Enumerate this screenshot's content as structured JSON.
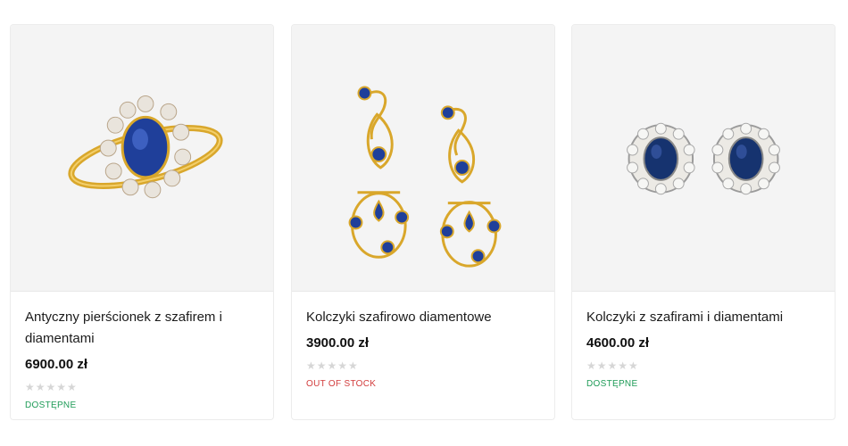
{
  "products": [
    {
      "title": "Antyczny pierścionek z szafirem i diamentami",
      "price": "6900.00 zł",
      "rating_stars": "★★★★★",
      "rating": 0,
      "stock": "DOSTĘPNE",
      "stock_status": "in-stock",
      "image": "sapphire-diamond-ring-image"
    },
    {
      "title": "Kolczyki szafirowo diamentowe",
      "price": "3900.00 zł",
      "rating_stars": "★★★★★",
      "rating": 0,
      "stock": "OUT OF STOCK",
      "stock_status": "out-of-stock",
      "image": "sapphire-drop-earrings-image"
    },
    {
      "title": "Kolczyki z szafirami i diamentami",
      "price": "4600.00 zł",
      "rating_stars": "★★★★★",
      "rating": 0,
      "stock": "DOSTĘPNE",
      "stock_status": "in-stock",
      "image": "sapphire-stud-earrings-image"
    }
  ],
  "colors": {
    "in_stock": "#1e9b57",
    "out_of_stock": "#d23c3c",
    "gold": "#d9a72b",
    "sapphire": "#1f3f9a"
  }
}
